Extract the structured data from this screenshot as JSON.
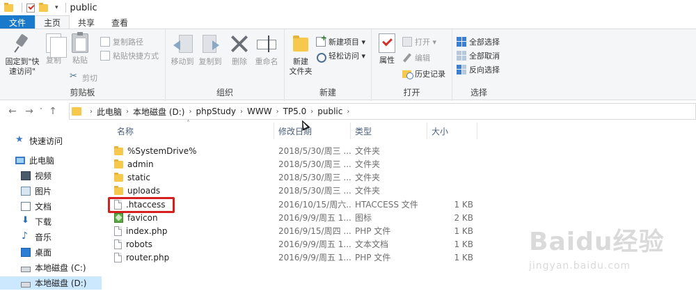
{
  "titlebar": {
    "title": "public"
  },
  "tabs": [
    "文件",
    "主页",
    "共享",
    "查看"
  ],
  "ribbon": {
    "clipboard": {
      "label": "剪贴板",
      "pin_label_1": "固定到\"快",
      "pin_label_2": "速访问\"",
      "copy": "复制",
      "paste": "粘贴",
      "copy_path": "复制路径",
      "paste_shortcut": "粘贴快捷方式",
      "cut": "剪切"
    },
    "organize": {
      "label": "组织",
      "move_to": "移动到",
      "copy_to": "复制到",
      "delete": "删除",
      "rename": "重命名"
    },
    "new": {
      "label": "新建",
      "new_folder_1": "新建",
      "new_folder_2": "文件夹",
      "new_item": "新建项目 ▾",
      "easy_access": "轻松访问 ▾"
    },
    "open": {
      "label": "打开",
      "properties": "属性",
      "open": "打开 ▾",
      "edit": "编辑",
      "history": "历史记录"
    },
    "select": {
      "label": "选择",
      "select_all": "全部选择",
      "select_none": "全部取消",
      "invert": "反向选择"
    }
  },
  "nav": {
    "back": "←",
    "forward": "→",
    "recent": "˅",
    "up": "↑"
  },
  "breadcrumbs": [
    "此电脑",
    "本地磁盘 (D:)",
    "phpStudy",
    "WWW",
    "TP5.0",
    "public"
  ],
  "leftnav": [
    {
      "label": "快速访问",
      "icon": "star-icon"
    },
    {
      "label": "此电脑",
      "icon": "computer-icon"
    },
    {
      "label": "视频",
      "icon": "video-icon"
    },
    {
      "label": "图片",
      "icon": "pictures-icon"
    },
    {
      "label": "文档",
      "icon": "documents-icon"
    },
    {
      "label": "下载",
      "icon": "download-icon"
    },
    {
      "label": "音乐",
      "icon": "music-icon"
    },
    {
      "label": "桌面",
      "icon": "desktop-icon"
    },
    {
      "label": "本地磁盘 (C:)",
      "icon": "drive-icon"
    },
    {
      "label": "本地磁盘 (D:)",
      "icon": "drive-icon"
    }
  ],
  "columns": {
    "name": "名称",
    "modified": "修改日期",
    "type": "类型",
    "size": "大小"
  },
  "files": [
    {
      "name": "%SystemDrive%",
      "modified": "2018/5/30/周三 ...",
      "type": "文件夹",
      "size": "",
      "icon": "folder"
    },
    {
      "name": "admin",
      "modified": "2018/5/30/周三 ...",
      "type": "文件夹",
      "size": "",
      "icon": "folder"
    },
    {
      "name": "static",
      "modified": "2018/5/30/周三 ...",
      "type": "文件夹",
      "size": "",
      "icon": "folder"
    },
    {
      "name": "uploads",
      "modified": "2018/5/30/周三 ...",
      "type": "文件夹",
      "size": "",
      "icon": "folder"
    },
    {
      "name": ".htaccess",
      "modified": "2016/10/15/周六...",
      "type": "HTACCESS 文件",
      "size": "1 KB",
      "icon": "file"
    },
    {
      "name": "favicon",
      "modified": "2016/9/9/周五 1...",
      "type": "图标",
      "size": "2 KB",
      "icon": "image"
    },
    {
      "name": "index.php",
      "modified": "2016/9/15/周四 ...",
      "type": "PHP 文件",
      "size": "1 KB",
      "icon": "file"
    },
    {
      "name": "robots",
      "modified": "2016/9/9/周五 1...",
      "type": "文本文档",
      "size": "1 KB",
      "icon": "file"
    },
    {
      "name": "router.php",
      "modified": "2016/9/9/周五 1...",
      "type": "PHP 文件",
      "size": "1 KB",
      "icon": "file"
    }
  ],
  "watermark": {
    "logo": "Baidu经验",
    "site": "jingyan.baidu.com"
  },
  "colors": {
    "accent": "#1979ca",
    "highlight": "#d62020",
    "selected": "#cce8ff",
    "folder": "#f6c84b"
  }
}
